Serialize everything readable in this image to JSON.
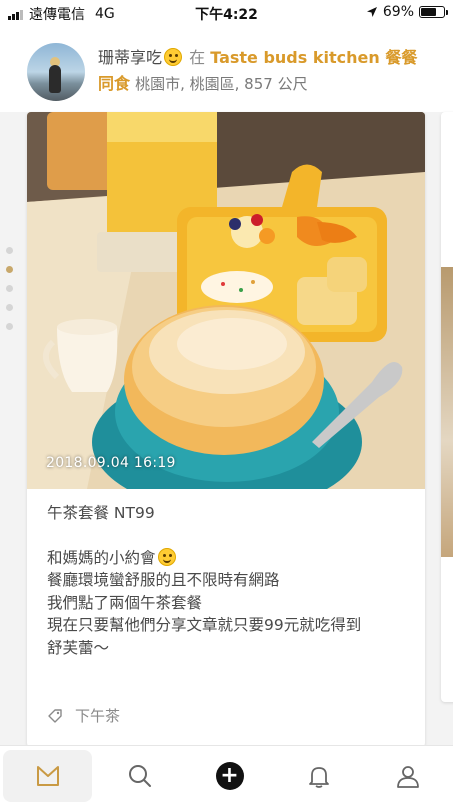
{
  "status_bar": {
    "carrier": "遠傳電信",
    "network": "4G",
    "time": "下午4:22",
    "battery_percent": "69%",
    "battery_level": 0.69
  },
  "post": {
    "user_name": "珊蒂享吃",
    "emoji_icon": "smiling-face-icon",
    "at_word": "在",
    "place_name": "Taste buds kitchen 餐餐同食",
    "location_detail": "桃園市, 桃園區, 857 公尺",
    "photo_date": "2018.09.04 16:19",
    "photo_index": 2,
    "photo_count": 5,
    "title_line": "午茶套餐 NT99",
    "body_lines": [
      "和媽媽的小約會",
      "餐廳環境蠻舒服的且不限時有網路",
      "我們點了兩個午茶套餐",
      "現在只要幫他們分享文章就只要99元就吃得到",
      "舒芙蕾～"
    ],
    "tag": "下午茶"
  },
  "tabbar": {
    "items": [
      "home-icon",
      "search-icon",
      "add-icon",
      "bell-icon",
      "profile-icon"
    ],
    "active": "home-icon"
  },
  "colors": {
    "accent": "#d99a2b",
    "text": "#4a4a4a",
    "muted": "#8a8a8a"
  }
}
